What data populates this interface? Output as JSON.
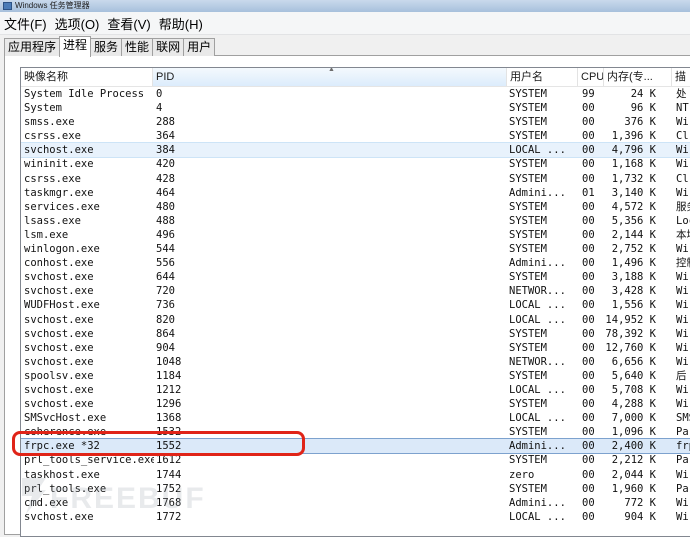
{
  "window": {
    "title": "Windows 任务管理器"
  },
  "menu": [
    "文件(F)",
    "选项(O)",
    "查看(V)",
    "帮助(H)"
  ],
  "tabs": [
    {
      "label": "应用程序",
      "active": false
    },
    {
      "label": "进程",
      "active": true
    },
    {
      "label": "服务",
      "active": false
    },
    {
      "label": "性能",
      "active": false
    },
    {
      "label": "联网",
      "active": false
    },
    {
      "label": "用户",
      "active": false
    }
  ],
  "columns": {
    "name": "映像名称",
    "pid": "PID",
    "user": "用户名",
    "cpu": "CPU",
    "mem": "内存(专...",
    "desc": "描"
  },
  "rows": [
    {
      "name": "System Idle Process",
      "pid": "0",
      "user": "SYSTEM",
      "cpu": "99",
      "mem": "24 K",
      "desc": "处"
    },
    {
      "name": "System",
      "pid": "4",
      "user": "SYSTEM",
      "cpu": "00",
      "mem": "96 K",
      "desc": "NT"
    },
    {
      "name": "smss.exe",
      "pid": "288",
      "user": "SYSTEM",
      "cpu": "00",
      "mem": "376 K",
      "desc": "Wi"
    },
    {
      "name": "csrss.exe",
      "pid": "364",
      "user": "SYSTEM",
      "cpu": "00",
      "mem": "1,396 K",
      "desc": "Cl"
    },
    {
      "name": "svchost.exe",
      "pid": "384",
      "user": "LOCAL ...",
      "cpu": "00",
      "mem": "4,796 K",
      "desc": "Wi"
    },
    {
      "name": "wininit.exe",
      "pid": "420",
      "user": "SYSTEM",
      "cpu": "00",
      "mem": "1,168 K",
      "desc": "Wi"
    },
    {
      "name": "csrss.exe",
      "pid": "428",
      "user": "SYSTEM",
      "cpu": "00",
      "mem": "1,732 K",
      "desc": "Cl"
    },
    {
      "name": "taskmgr.exe",
      "pid": "464",
      "user": "Admini...",
      "cpu": "01",
      "mem": "3,140 K",
      "desc": "Wi"
    },
    {
      "name": "services.exe",
      "pid": "480",
      "user": "SYSTEM",
      "cpu": "00",
      "mem": "4,572 K",
      "desc": "服务"
    },
    {
      "name": "lsass.exe",
      "pid": "488",
      "user": "SYSTEM",
      "cpu": "00",
      "mem": "5,356 K",
      "desc": "Loc"
    },
    {
      "name": "lsm.exe",
      "pid": "496",
      "user": "SYSTEM",
      "cpu": "00",
      "mem": "2,144 K",
      "desc": "本地"
    },
    {
      "name": "winlogon.exe",
      "pid": "544",
      "user": "SYSTEM",
      "cpu": "00",
      "mem": "2,752 K",
      "desc": "Wi"
    },
    {
      "name": "conhost.exe",
      "pid": "556",
      "user": "Admini...",
      "cpu": "00",
      "mem": "1,496 K",
      "desc": "控制"
    },
    {
      "name": "svchost.exe",
      "pid": "644",
      "user": "SYSTEM",
      "cpu": "00",
      "mem": "3,188 K",
      "desc": "Wi"
    },
    {
      "name": "svchost.exe",
      "pid": "720",
      "user": "NETWOR...",
      "cpu": "00",
      "mem": "3,428 K",
      "desc": "Wi"
    },
    {
      "name": "WUDFHost.exe",
      "pid": "736",
      "user": "LOCAL ...",
      "cpu": "00",
      "mem": "1,556 K",
      "desc": "Wi"
    },
    {
      "name": "svchost.exe",
      "pid": "820",
      "user": "LOCAL ...",
      "cpu": "00",
      "mem": "14,952 K",
      "desc": "Wi"
    },
    {
      "name": "svchost.exe",
      "pid": "864",
      "user": "SYSTEM",
      "cpu": "00",
      "mem": "78,392 K",
      "desc": "Wi"
    },
    {
      "name": "svchost.exe",
      "pid": "904",
      "user": "SYSTEM",
      "cpu": "00",
      "mem": "12,760 K",
      "desc": "Wi"
    },
    {
      "name": "svchost.exe",
      "pid": "1048",
      "user": "NETWOR...",
      "cpu": "00",
      "mem": "6,656 K",
      "desc": "Wi"
    },
    {
      "name": "spoolsv.exe",
      "pid": "1184",
      "user": "SYSTEM",
      "cpu": "00",
      "mem": "5,640 K",
      "desc": "后"
    },
    {
      "name": "svchost.exe",
      "pid": "1212",
      "user": "LOCAL ...",
      "cpu": "00",
      "mem": "5,708 K",
      "desc": "Wi"
    },
    {
      "name": "svchost.exe",
      "pid": "1296",
      "user": "SYSTEM",
      "cpu": "00",
      "mem": "4,288 K",
      "desc": "Wi"
    },
    {
      "name": "SMSvcHost.exe",
      "pid": "1368",
      "user": "LOCAL ...",
      "cpu": "00",
      "mem": "7,000 K",
      "desc": "SMS"
    },
    {
      "name": "coherence.exe",
      "pid": "1532",
      "user": "SYSTEM",
      "cpu": "00",
      "mem": "1,096 K",
      "desc": "Par"
    },
    {
      "name": "frpc.exe *32",
      "pid": "1552",
      "user": "Admini...",
      "cpu": "00",
      "mem": "2,400 K",
      "desc": "frp"
    },
    {
      "name": "prl_tools_service.exe",
      "pid": "1612",
      "user": "SYSTEM",
      "cpu": "00",
      "mem": "2,212 K",
      "desc": "Par"
    },
    {
      "name": "taskhost.exe",
      "pid": "1744",
      "user": "zero",
      "cpu": "00",
      "mem": "2,044 K",
      "desc": "Wi"
    },
    {
      "name": "prl_tools.exe",
      "pid": "1752",
      "user": "SYSTEM",
      "cpu": "00",
      "mem": "1,960 K",
      "desc": "Par"
    },
    {
      "name": "cmd.exe",
      "pid": "1768",
      "user": "Admini...",
      "cpu": "00",
      "mem": "772 K",
      "desc": "Wi"
    },
    {
      "name": "svchost.exe",
      "pid": "1772",
      "user": "LOCAL ...",
      "cpu": "00",
      "mem": "904 K",
      "desc": "Wi"
    }
  ],
  "hover_row_index": 4,
  "selected_row_index": 25,
  "watermark": {
    "text": "FREEBUF"
  },
  "colors": {
    "highlight_box": "#e02418",
    "selection": "#dbe9f9"
  }
}
